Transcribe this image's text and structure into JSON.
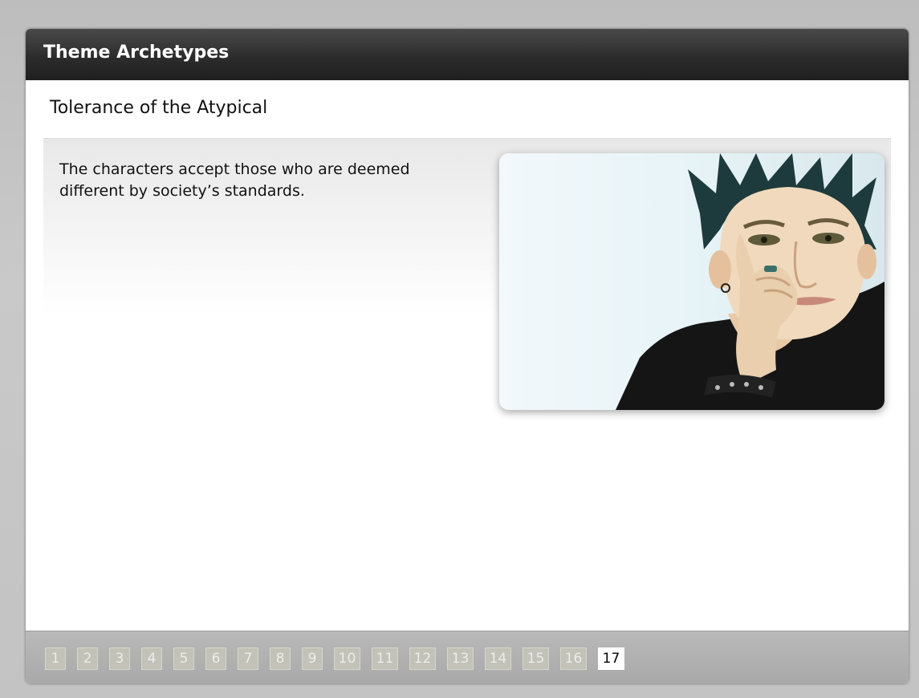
{
  "header": {
    "title": "Theme Archetypes"
  },
  "slide": {
    "subtitle": "Tolerance of the Atypical",
    "body_text": "The characters accept those who are deemed different by society’s standards.",
    "image_description": "Portrait of a young man with spiky dark hair resting his chin on his hand"
  },
  "pager": {
    "pages": [
      "1",
      "2",
      "3",
      "4",
      "5",
      "6",
      "7",
      "8",
      "9",
      "10",
      "11",
      "12",
      "13",
      "14",
      "15",
      "16",
      "17"
    ],
    "current": "17"
  },
  "colors": {
    "header_bg": "#2c2c2c",
    "page_bg": "#c6c6c6",
    "pager_inactive": "#c2c2b8",
    "pager_active": "#ffffff"
  }
}
